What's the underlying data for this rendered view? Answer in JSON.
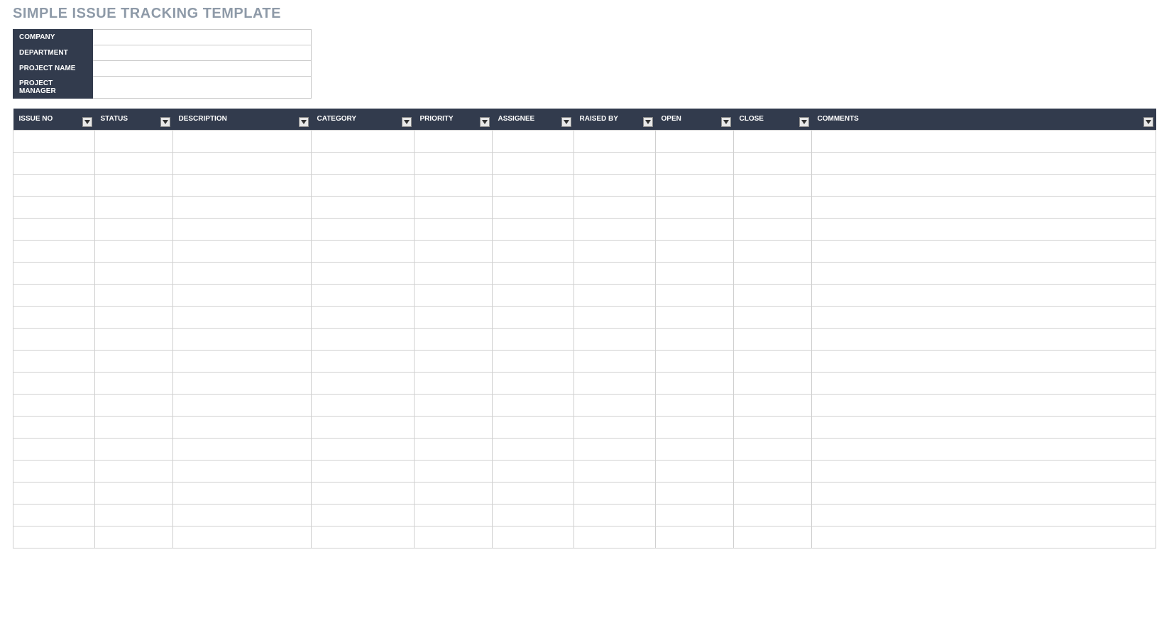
{
  "title": "SIMPLE ISSUE TRACKING TEMPLATE",
  "meta": {
    "company_label": "COMPANY",
    "company_value": "",
    "department_label": "DEPARTMENT",
    "department_value": "",
    "project_name_label": "PROJECT NAME",
    "project_name_value": "",
    "project_manager_label": "PROJECT MANAGER",
    "project_manager_value": ""
  },
  "columns": {
    "issue_no": "ISSUE NO",
    "status": "STATUS",
    "description": "DESCRIPTION",
    "category": "CATEGORY",
    "priority": "PRIORITY",
    "assignee": "ASSIGNEE",
    "raised_by": "RAISED BY",
    "open": "OPEN",
    "close": "CLOSE",
    "comments": "COMMENTS"
  },
  "rows": [
    {
      "issue_no": "",
      "status": "",
      "description": "",
      "category": "",
      "priority": "",
      "assignee": "",
      "raised_by": "",
      "open": "",
      "close": "",
      "comments": ""
    },
    {
      "issue_no": "",
      "status": "",
      "description": "",
      "category": "",
      "priority": "",
      "assignee": "",
      "raised_by": "",
      "open": "",
      "close": "",
      "comments": ""
    },
    {
      "issue_no": "",
      "status": "",
      "description": "",
      "category": "",
      "priority": "",
      "assignee": "",
      "raised_by": "",
      "open": "",
      "close": "",
      "comments": ""
    },
    {
      "issue_no": "",
      "status": "",
      "description": "",
      "category": "",
      "priority": "",
      "assignee": "",
      "raised_by": "",
      "open": "",
      "close": "",
      "comments": ""
    },
    {
      "issue_no": "",
      "status": "",
      "description": "",
      "category": "",
      "priority": "",
      "assignee": "",
      "raised_by": "",
      "open": "",
      "close": "",
      "comments": ""
    },
    {
      "issue_no": "",
      "status": "",
      "description": "",
      "category": "",
      "priority": "",
      "assignee": "",
      "raised_by": "",
      "open": "",
      "close": "",
      "comments": ""
    },
    {
      "issue_no": "",
      "status": "",
      "description": "",
      "category": "",
      "priority": "",
      "assignee": "",
      "raised_by": "",
      "open": "",
      "close": "",
      "comments": ""
    },
    {
      "issue_no": "",
      "status": "",
      "description": "",
      "category": "",
      "priority": "",
      "assignee": "",
      "raised_by": "",
      "open": "",
      "close": "",
      "comments": ""
    },
    {
      "issue_no": "",
      "status": "",
      "description": "",
      "category": "",
      "priority": "",
      "assignee": "",
      "raised_by": "",
      "open": "",
      "close": "",
      "comments": ""
    },
    {
      "issue_no": "",
      "status": "",
      "description": "",
      "category": "",
      "priority": "",
      "assignee": "",
      "raised_by": "",
      "open": "",
      "close": "",
      "comments": ""
    },
    {
      "issue_no": "",
      "status": "",
      "description": "",
      "category": "",
      "priority": "",
      "assignee": "",
      "raised_by": "",
      "open": "",
      "close": "",
      "comments": ""
    },
    {
      "issue_no": "",
      "status": "",
      "description": "",
      "category": "",
      "priority": "",
      "assignee": "",
      "raised_by": "",
      "open": "",
      "close": "",
      "comments": ""
    },
    {
      "issue_no": "",
      "status": "",
      "description": "",
      "category": "",
      "priority": "",
      "assignee": "",
      "raised_by": "",
      "open": "",
      "close": "",
      "comments": ""
    },
    {
      "issue_no": "",
      "status": "",
      "description": "",
      "category": "",
      "priority": "",
      "assignee": "",
      "raised_by": "",
      "open": "",
      "close": "",
      "comments": ""
    },
    {
      "issue_no": "",
      "status": "",
      "description": "",
      "category": "",
      "priority": "",
      "assignee": "",
      "raised_by": "",
      "open": "",
      "close": "",
      "comments": ""
    },
    {
      "issue_no": "",
      "status": "",
      "description": "",
      "category": "",
      "priority": "",
      "assignee": "",
      "raised_by": "",
      "open": "",
      "close": "",
      "comments": ""
    },
    {
      "issue_no": "",
      "status": "",
      "description": "",
      "category": "",
      "priority": "",
      "assignee": "",
      "raised_by": "",
      "open": "",
      "close": "",
      "comments": ""
    },
    {
      "issue_no": "",
      "status": "",
      "description": "",
      "category": "",
      "priority": "",
      "assignee": "",
      "raised_by": "",
      "open": "",
      "close": "",
      "comments": ""
    },
    {
      "issue_no": "",
      "status": "",
      "description": "",
      "category": "",
      "priority": "",
      "assignee": "",
      "raised_by": "",
      "open": "",
      "close": "",
      "comments": ""
    }
  ]
}
